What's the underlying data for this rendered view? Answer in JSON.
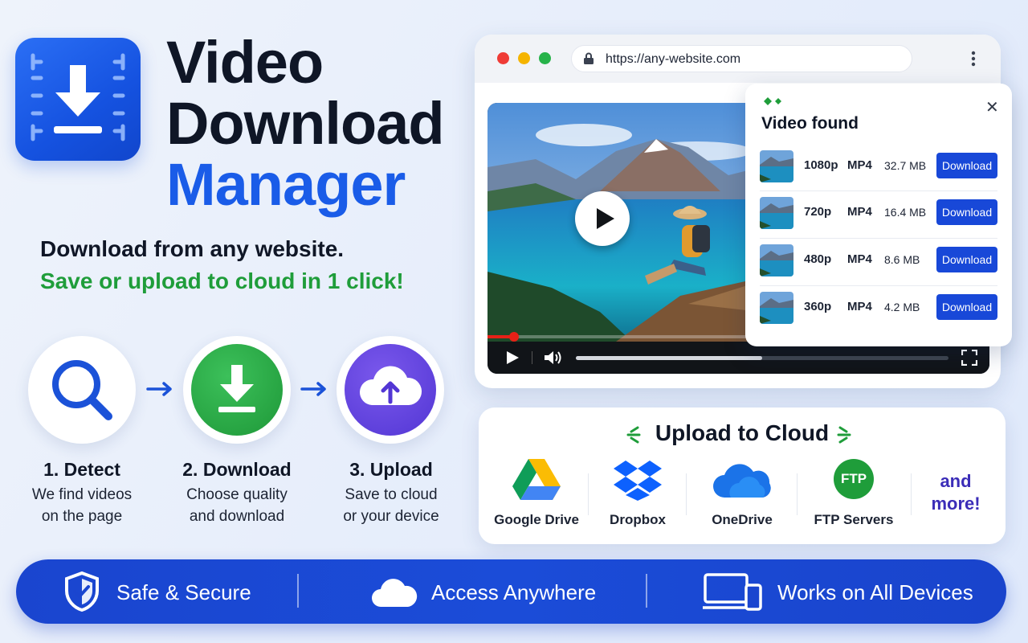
{
  "title": {
    "line1": "Video",
    "line2": "Download",
    "line3": "Manager"
  },
  "tagline": {
    "primary": "Download from any website.",
    "secondary": "Save or upload to cloud in 1 click!"
  },
  "steps": [
    {
      "title": "1. Detect",
      "desc1": "We find videos",
      "desc2": "on the page",
      "icon": "search-icon"
    },
    {
      "title": "2. Download",
      "desc1": "Choose quality",
      "desc2": "and download",
      "icon": "download-icon"
    },
    {
      "title": "3. Upload",
      "desc1": "Save to cloud",
      "desc2": "or your device",
      "icon": "cloud-upload-icon"
    }
  ],
  "browser": {
    "url": "https://any-website.com"
  },
  "player": {
    "progress": 0.02,
    "buffer": 0.5
  },
  "popup": {
    "title": "Video found",
    "close": "✕",
    "rows": [
      {
        "resolution": "1080p",
        "format": "MP4",
        "size": "32.7 MB",
        "action": "Download"
      },
      {
        "resolution": "720p",
        "format": "MP4",
        "size": "16.4 MB",
        "action": "Download"
      },
      {
        "resolution": "480p",
        "format": "MP4",
        "size": "8.6 MB",
        "action": "Download"
      },
      {
        "resolution": "360p",
        "format": "MP4",
        "size": "4.2 MB",
        "action": "Download"
      }
    ]
  },
  "cloud": {
    "title": "Upload to Cloud",
    "services": [
      {
        "name": "Google Drive",
        "icon": "google-drive-icon"
      },
      {
        "name": "Dropbox",
        "icon": "dropbox-icon"
      },
      {
        "name": "OneDrive",
        "icon": "onedrive-icon"
      },
      {
        "name": "FTP Servers",
        "icon": "ftp-icon",
        "badge": "FTP"
      }
    ],
    "more_line1": "and",
    "more_line2": "more!"
  },
  "features": [
    {
      "label": "Safe & Secure",
      "icon": "shield-icon"
    },
    {
      "label": "Access Anywhere",
      "icon": "cloud-icon"
    },
    {
      "label": "Works on All Devices",
      "icon": "devices-icon"
    }
  ],
  "colors": {
    "brand_blue": "#1a5ce8",
    "accent_green": "#1f9d3a",
    "download_button": "#1848d8",
    "more_purple": "#3b2db8"
  }
}
